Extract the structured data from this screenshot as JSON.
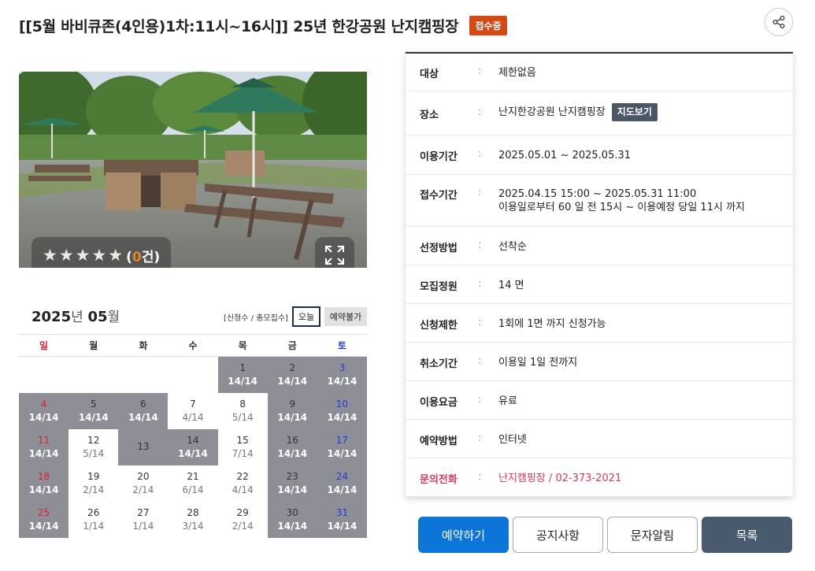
{
  "header": {
    "title": "[[5월 바비큐존(4인용)1차:11시~16시]] 25년 한강공원 난지캠핑장",
    "status_badge": "접수중",
    "share_icon": "share-icon"
  },
  "photo": {
    "rating_stars": "★★★★★",
    "rating_open": "(",
    "rating_count": "0",
    "rating_close": "건)",
    "rating_value": 0,
    "expand_icon": "expand-icon"
  },
  "calendar": {
    "year": "2025",
    "year_unit": "년",
    "month": "05",
    "month_unit": "월",
    "legend": "[신청수 / 총모집수]",
    "today_label": "오늘",
    "unavailable_label": "예약불가",
    "weekdays": [
      "일",
      "월",
      "화",
      "수",
      "목",
      "금",
      "토"
    ],
    "weeks": [
      [
        {
          "day": "",
          "count": "",
          "state": "empty"
        },
        {
          "day": "",
          "count": "",
          "state": "empty"
        },
        {
          "day": "",
          "count": "",
          "state": "empty"
        },
        {
          "day": "",
          "count": "",
          "state": "empty"
        },
        {
          "day": "1",
          "count": "14/14",
          "state": "full"
        },
        {
          "day": "2",
          "count": "14/14",
          "state": "full"
        },
        {
          "day": "3",
          "count": "14/14",
          "state": "full"
        }
      ],
      [
        {
          "day": "4",
          "count": "14/14",
          "state": "full"
        },
        {
          "day": "5",
          "count": "14/14",
          "state": "full"
        },
        {
          "day": "6",
          "count": "14/14",
          "state": "full"
        },
        {
          "day": "7",
          "count": "4/14",
          "state": "open"
        },
        {
          "day": "8",
          "count": "5/14",
          "state": "open"
        },
        {
          "day": "9",
          "count": "14/14",
          "state": "full"
        },
        {
          "day": "10",
          "count": "14/14",
          "state": "full"
        }
      ],
      [
        {
          "day": "11",
          "count": "14/14",
          "state": "full"
        },
        {
          "day": "12",
          "count": "5/14",
          "state": "open"
        },
        {
          "day": "13",
          "count": "",
          "state": "full"
        },
        {
          "day": "14",
          "count": "14/14",
          "state": "full"
        },
        {
          "day": "15",
          "count": "7/14",
          "state": "open"
        },
        {
          "day": "16",
          "count": "14/14",
          "state": "full"
        },
        {
          "day": "17",
          "count": "14/14",
          "state": "full"
        }
      ],
      [
        {
          "day": "18",
          "count": "14/14",
          "state": "full"
        },
        {
          "day": "19",
          "count": "2/14",
          "state": "open"
        },
        {
          "day": "20",
          "count": "2/14",
          "state": "open"
        },
        {
          "day": "21",
          "count": "6/14",
          "state": "open"
        },
        {
          "day": "22",
          "count": "4/14",
          "state": "open"
        },
        {
          "day": "23",
          "count": "14/14",
          "state": "full"
        },
        {
          "day": "24",
          "count": "14/14",
          "state": "full"
        }
      ],
      [
        {
          "day": "25",
          "count": "14/14",
          "state": "full"
        },
        {
          "day": "26",
          "count": "1/14",
          "state": "open"
        },
        {
          "day": "27",
          "count": "1/14",
          "state": "open"
        },
        {
          "day": "28",
          "count": "3/14",
          "state": "open"
        },
        {
          "day": "29",
          "count": "2/14",
          "state": "open"
        },
        {
          "day": "30",
          "count": "14/14",
          "state": "full"
        },
        {
          "day": "31",
          "count": "14/14",
          "state": "full"
        }
      ]
    ]
  },
  "info": {
    "separator": ":",
    "rows": [
      {
        "label": "대상",
        "value": "제한없음"
      },
      {
        "label": "장소",
        "value": "난지한강공원 난지캠핑장",
        "button": "지도보기"
      },
      {
        "label": "이용기간",
        "value": "2025.05.01 ~ 2025.05.31"
      },
      {
        "label": "접수기간",
        "value": "2025.04.15 15:00 ~ 2025.05.31 11:00",
        "value2": "이용일로부터 60 일 전 15시 ~ 이용예정 당일 11시 까지"
      },
      {
        "label": "선정방법",
        "value": "선착순"
      },
      {
        "label": "모집정원",
        "value": "14 면"
      },
      {
        "label": "신청제한",
        "value": "1회에 1면 까지 신청가능"
      },
      {
        "label": "취소기간",
        "value": "이용일 1일 전까지"
      },
      {
        "label": "이용요금",
        "value": "유료"
      },
      {
        "label": "예약방법",
        "value": "인터넷"
      },
      {
        "label": "문의전화",
        "value": "난지캠핑장 / 02-373-2021"
      }
    ]
  },
  "actions": {
    "reserve": "예약하기",
    "notice": "공지사항",
    "sms": "문자알림",
    "list": "목록"
  },
  "colors": {
    "status_badge": "#d24a16",
    "primary_button": "#0b75d8",
    "list_button": "#485a6d",
    "full_cell": "#8e8f96",
    "contact_text": "#d23a5a",
    "sunday": "#d9232f",
    "saturday": "#1f3bd9"
  }
}
